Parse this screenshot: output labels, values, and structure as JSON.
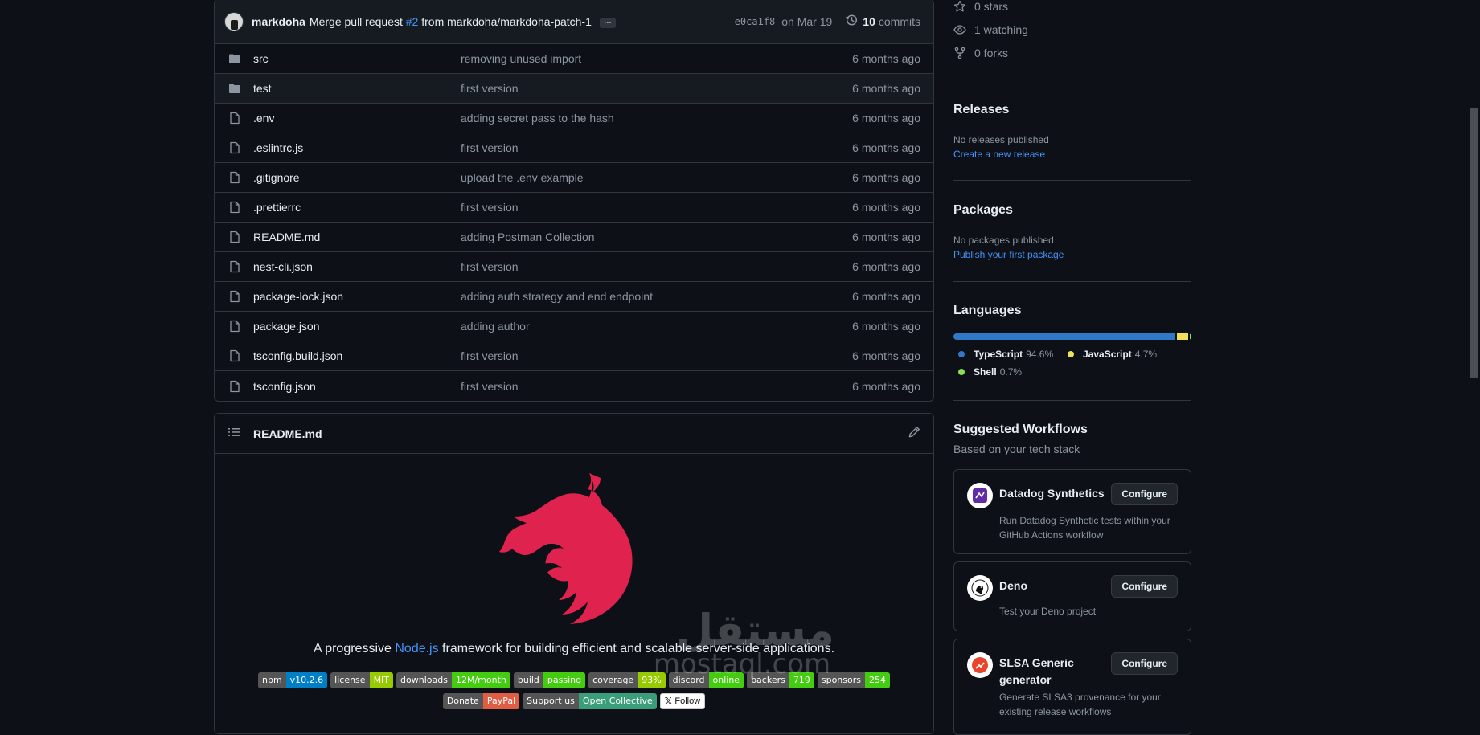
{
  "commit": {
    "user": "markdoha",
    "message_prefix": "Merge pull request ",
    "pr": "#2",
    "message_suffix": " from markdoha/markdoha-patch-1",
    "ellipsis": "…",
    "sha": "e0ca1f8",
    "date": "on Mar 19",
    "commit_count": "10",
    "commits_label": "commits"
  },
  "files": [
    {
      "type": "folder",
      "name": "src",
      "message": "removing unused import",
      "age": "6 months ago"
    },
    {
      "type": "folder",
      "name": "test",
      "message": "first version",
      "age": "6 months ago"
    },
    {
      "type": "file",
      "name": ".env",
      "message": "adding secret pass to the hash",
      "age": "6 months ago"
    },
    {
      "type": "file",
      "name": ".eslintrc.js",
      "message": "first version",
      "age": "6 months ago"
    },
    {
      "type": "file",
      "name": ".gitignore",
      "message": "upload the .env example",
      "age": "6 months ago"
    },
    {
      "type": "file",
      "name": ".prettierrc",
      "message": "first version",
      "age": "6 months ago"
    },
    {
      "type": "file",
      "name": "README.md",
      "message": "adding Postman Collection",
      "age": "6 months ago"
    },
    {
      "type": "file",
      "name": "nest-cli.json",
      "message": "first version",
      "age": "6 months ago"
    },
    {
      "type": "file",
      "name": "package-lock.json",
      "message": "adding auth strategy and end endpoint",
      "age": "6 months ago"
    },
    {
      "type": "file",
      "name": "package.json",
      "message": "adding author",
      "age": "6 months ago"
    },
    {
      "type": "file",
      "name": "tsconfig.build.json",
      "message": "first version",
      "age": "6 months ago"
    },
    {
      "type": "file",
      "name": "tsconfig.json",
      "message": "first version",
      "age": "6 months ago"
    }
  ],
  "readme": {
    "title": "README.md",
    "tagline_prefix": "A progressive ",
    "tagline_link": "Node.js",
    "tagline_suffix": " framework for building efficient and scalable server-side applications.",
    "badges_row1": [
      {
        "left": "npm",
        "right": "v10.2.6",
        "color": "#007ec6"
      },
      {
        "left": "license",
        "right": "MIT",
        "color": "#97ca00"
      },
      {
        "left": "downloads",
        "right": "12M/month",
        "color": "#4c1"
      },
      {
        "left": "build",
        "right": "passing",
        "color": "#4c1"
      },
      {
        "left": "coverage",
        "right": "93%",
        "color": "#97ca00"
      },
      {
        "left": "discord",
        "right": "online",
        "color": "#4c1"
      },
      {
        "left": "backers",
        "right": "719",
        "color": "#4c1"
      },
      {
        "left": "sponsors",
        "right": "254",
        "color": "#4c1"
      }
    ],
    "badges_row2": [
      {
        "left": "Donate",
        "right": "PayPal",
        "color": "#e05d44"
      },
      {
        "left": "Support us",
        "right": "Open Collective",
        "color": "#3a9e7b"
      }
    ],
    "follow_x": "𝕏",
    "follow_label": "Follow"
  },
  "sidebar": {
    "stars": "0 stars",
    "watching": "1 watching",
    "forks": "0 forks",
    "releases_title": "Releases",
    "releases_text": "No releases published",
    "releases_link": "Create a new release",
    "packages_title": "Packages",
    "packages_text": "No packages published",
    "packages_link": "Publish your first package",
    "languages_title": "Languages",
    "languages": [
      {
        "name": "TypeScript",
        "pct": "94.6%",
        "value": 94.6,
        "color": "#3178c6"
      },
      {
        "name": "JavaScript",
        "pct": "4.7%",
        "value": 4.7,
        "color": "#f1e05a"
      },
      {
        "name": "Shell",
        "pct": "0.7%",
        "value": 0.7,
        "color": "#89e051"
      }
    ],
    "workflows_title": "Suggested Workflows",
    "workflows_subtitle": "Based on your tech stack",
    "workflows": [
      {
        "name": "Datadog Synthetics",
        "desc": "Run Datadog Synthetic tests within your GitHub Actions workflow",
        "button": "Configure"
      },
      {
        "name": "Deno",
        "desc": "Test your Deno project",
        "button": "Configure"
      },
      {
        "name": "SLSA Generic generator",
        "desc": "Generate SLSA3 provenance for your existing release workflows",
        "button": "Configure"
      }
    ]
  },
  "watermark": {
    "arabic": "مستقل",
    "latin": "mostaql.com"
  }
}
